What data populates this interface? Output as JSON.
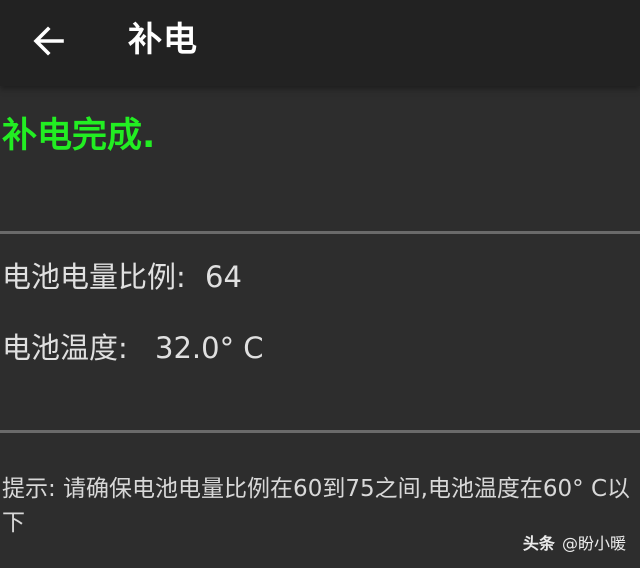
{
  "header": {
    "title": "补电",
    "back_icon": "arrow-left-icon"
  },
  "status": {
    "message": "补电完成.",
    "color": "#22ee22"
  },
  "battery": {
    "level_label": "电池电量比例:",
    "level_value": "64",
    "temp_label": "电池温度:",
    "temp_value": "32.0° C"
  },
  "hint": {
    "text": "提示: 请确保电池电量比例在60到75之间,电池温度在60° C以下"
  },
  "watermark": {
    "brand": "头条",
    "handle": "@盼小暖"
  }
}
